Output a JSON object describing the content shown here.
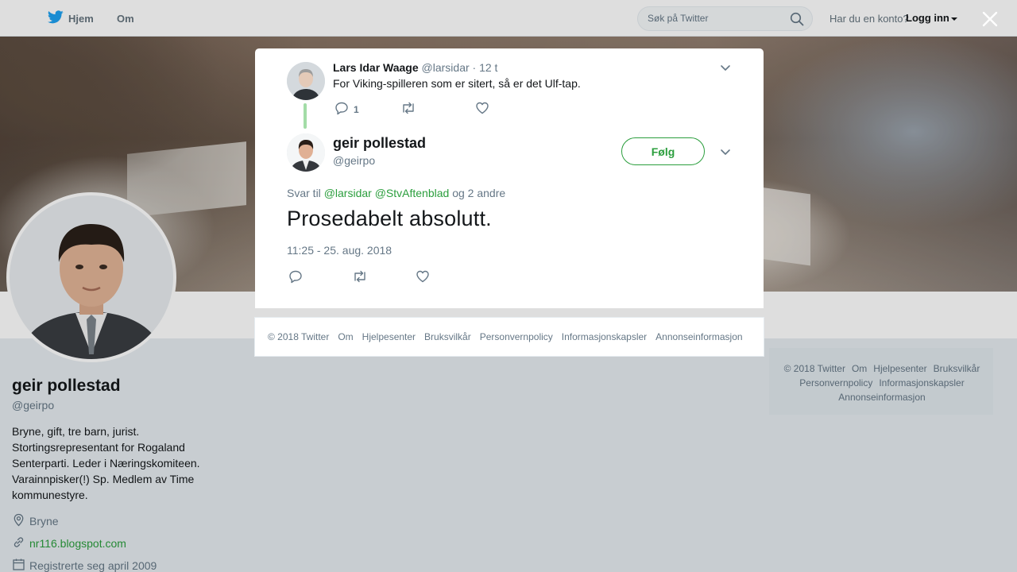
{
  "topbar": {
    "home_label": "Hjem",
    "about_label": "Om",
    "search_placeholder": "Søk på Twitter",
    "login_prompt": "Har du en konto?",
    "login_label": "Logg inn"
  },
  "profile": {
    "name": "geir pollestad",
    "handle": "@geirpo",
    "bio": "Bryne, gift, tre barn, jurist. Stortingsrepresentant for Rogaland Senterparti. Leder i Næringskomiteen. Varainnpisker(!) Sp. Medlem av Time kommunestyre.",
    "location": "Bryne",
    "website": "nr116.blogspot.com",
    "joined": "Registrerte seg april 2009"
  },
  "side_footer": [
    "© 2018 Twitter",
    "Om",
    "Hjelpesenter",
    "Bruksvilkår",
    "Personvernpolicy",
    "Informasjonskapsler",
    "Annonseinformasjon"
  ],
  "modal": {
    "parent_tweet": {
      "name": "Lars Idar Waage",
      "handle": "@larsidar",
      "time": "· 12 t",
      "text": "For Viking-spilleren som er sitert, så er det Ulf-tap.",
      "reply_count": "1"
    },
    "tweet": {
      "name": "geir pollestad",
      "handle": "@geirpo",
      "follow_label": "Følg",
      "reply_prefix": "Svar til",
      "mention_1": "@larsidar",
      "mention_2": "@StvAftenblad",
      "reply_suffix": "og 2 andre",
      "text": "Prosedabelt absolutt.",
      "timestamp": "11:25 - 25. aug. 2018"
    },
    "footer_links": [
      "© 2018 Twitter",
      "Om",
      "Hjelpesenter",
      "Bruksvilkår",
      "Personvernpolicy",
      "Informasjonskapsler",
      "Annonseinformasjon"
    ]
  },
  "colors": {
    "accent_green": "#2b9e3d",
    "twitter_blue": "#1da1f2",
    "muted_text": "#657786"
  },
  "icons": [
    "twitter-bird-icon",
    "search-icon",
    "close-icon",
    "chevron-down-icon",
    "reply-icon",
    "retweet-icon",
    "like-icon",
    "location-icon",
    "link-icon",
    "calendar-icon"
  ]
}
